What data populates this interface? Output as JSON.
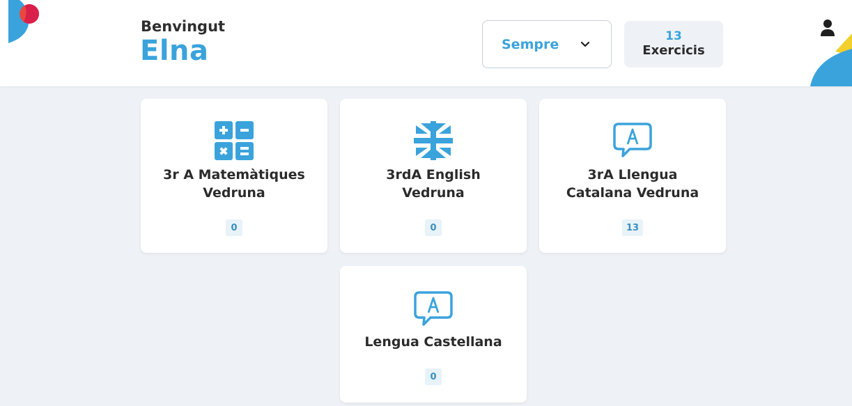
{
  "header": {
    "welcome": "Benvingut",
    "user_name": "Elna",
    "period_select": {
      "value": "Sempre"
    },
    "exercises": {
      "count": "13",
      "label": "Exercicis"
    }
  },
  "colors": {
    "accent": "#3aa3dc",
    "background": "#eef2f6",
    "card": "#ffffff",
    "badge_bg": "#e8f2f9"
  },
  "courses": [
    {
      "title_line1": "3r A Matemàtiques",
      "title_line2": "Vedruna",
      "count": "0",
      "icon": "calculator-icon"
    },
    {
      "title_line1": "3rdA English",
      "title_line2": "Vedruna",
      "count": "0",
      "icon": "union-jack-icon"
    },
    {
      "title_line1": "3rA Llengua",
      "title_line2": "Catalana Vedruna",
      "count": "13",
      "icon": "speech-bubble-a-icon"
    },
    {
      "title_line1": "Lengua Castellana",
      "title_line2": "",
      "count": "0",
      "icon": "speech-bubble-a-icon"
    }
  ]
}
